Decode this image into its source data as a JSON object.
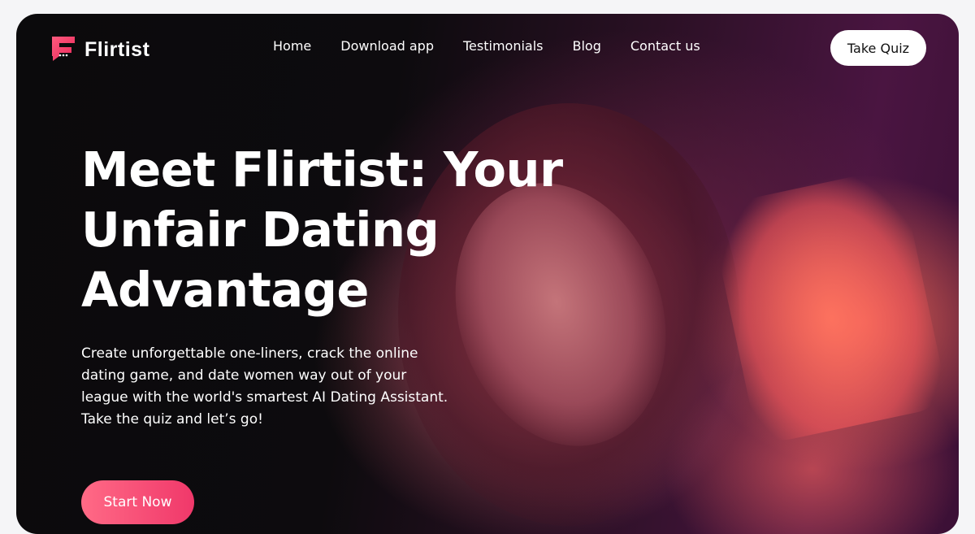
{
  "brand": {
    "name": "Flirtist",
    "logo_icon": "flirtist-chat-bubble-icon",
    "accent_color": "#f2426b"
  },
  "nav": {
    "links": [
      "Home",
      "Download app",
      "Testimonials",
      "Blog",
      "Contact us"
    ],
    "cta_label": "Take Quiz"
  },
  "hero": {
    "headline": "Meet Flirtist: Your Unfair Dating Advantage",
    "subtext": "Create unforgettable one-liners, crack the online dating game, and date women way out of your league with the world's smartest AI Dating Assistant. Take the quiz and let’s go!",
    "cta_label": "Start Now",
    "background_image": "woman-with-phone-photo"
  }
}
